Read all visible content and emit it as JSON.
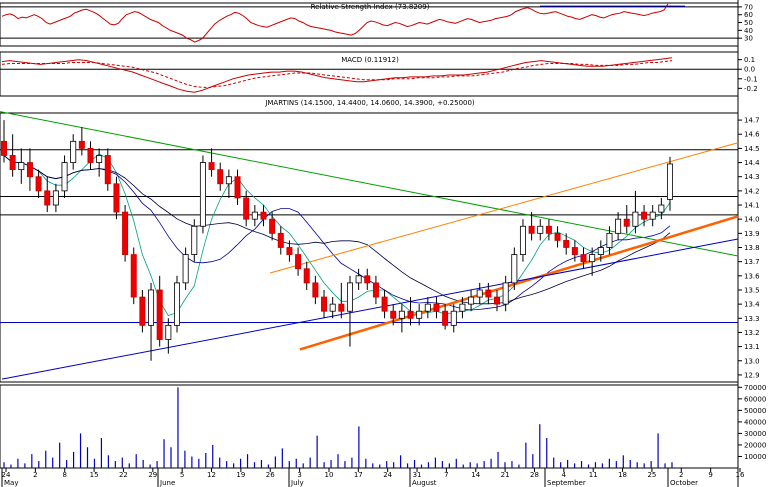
{
  "chart_data": {
    "type": "candlestick",
    "panels": {
      "rsi": {
        "title": "Relative Strength Index (73.8209)",
        "yticks": [
          70,
          60,
          50,
          40,
          30
        ],
        "ylim": [
          20,
          75
        ],
        "levels": [
          70,
          30
        ],
        "values": [
          58,
          60,
          61,
          59,
          55,
          57,
          56,
          58,
          60,
          58,
          55,
          50,
          48,
          50,
          52,
          54,
          56,
          58,
          62,
          64,
          66,
          67,
          65,
          63,
          60,
          56,
          52,
          48,
          47,
          49,
          55,
          60,
          62,
          64,
          63,
          60,
          57,
          54,
          52,
          50,
          46,
          43,
          40,
          38,
          36,
          34,
          30,
          28,
          25,
          27,
          30,
          36,
          42,
          48,
          52,
          55,
          58,
          60,
          63,
          62,
          59,
          55,
          50,
          48,
          46,
          45,
          44,
          46,
          48,
          50,
          52,
          54,
          56,
          55,
          52,
          50,
          47,
          45,
          44,
          43,
          42,
          41,
          40,
          38,
          37,
          36,
          35,
          34,
          36,
          40,
          45,
          50,
          52,
          51,
          49,
          47,
          46,
          48,
          50,
          49,
          47,
          45,
          46,
          48,
          50,
          49,
          48,
          50,
          52,
          54,
          53,
          51,
          50,
          49,
          51,
          53,
          55,
          54,
          52,
          50,
          51,
          52,
          53,
          55,
          56,
          57,
          58,
          60,
          64,
          66,
          68,
          69,
          67,
          64,
          62,
          61,
          62,
          63,
          64,
          62,
          60,
          58,
          57,
          55,
          54,
          56,
          58,
          60,
          59,
          57,
          56,
          58,
          60,
          61,
          62,
          64,
          63,
          62,
          61,
          60,
          59,
          60,
          62,
          63,
          64,
          66,
          73.8
        ]
      },
      "macd": {
        "title": "MACD (0.11912)",
        "yticks": [
          0.1,
          0.0,
          -0.1,
          -0.2
        ],
        "ylim": [
          -0.28,
          0.18
        ],
        "macd": [
          0.08,
          0.09,
          0.08,
          0.07,
          0.06,
          0.05,
          0.06,
          0.07,
          0.08,
          0.09,
          0.1,
          0.09,
          0.07,
          0.05,
          0.03,
          0.01,
          -0.01,
          -0.03,
          -0.06,
          -0.09,
          -0.12,
          -0.15,
          -0.18,
          -0.21,
          -0.23,
          -0.24,
          -0.22,
          -0.19,
          -0.16,
          -0.13,
          -0.1,
          -0.08,
          -0.06,
          -0.05,
          -0.04,
          -0.03,
          -0.03,
          -0.02,
          -0.02,
          -0.03,
          -0.05,
          -0.07,
          -0.09,
          -0.1,
          -0.11,
          -0.12,
          -0.13,
          -0.13,
          -0.12,
          -0.11,
          -0.1,
          -0.09,
          -0.09,
          -0.08,
          -0.08,
          -0.08,
          -0.07,
          -0.07,
          -0.06,
          -0.06,
          -0.06,
          -0.05,
          -0.04,
          -0.03,
          -0.01,
          0.01,
          0.03,
          0.05,
          0.07,
          0.08,
          0.09,
          0.08,
          0.07,
          0.06,
          0.05,
          0.04,
          0.03,
          0.03,
          0.03,
          0.04,
          0.05,
          0.06,
          0.07,
          0.08,
          0.09,
          0.1,
          0.11,
          0.12
        ],
        "signal": [
          0.05,
          0.06,
          0.06,
          0.06,
          0.06,
          0.06,
          0.06,
          0.06,
          0.06,
          0.07,
          0.07,
          0.07,
          0.07,
          0.06,
          0.05,
          0.04,
          0.03,
          0.02,
          0.0,
          -0.02,
          -0.04,
          -0.07,
          -0.1,
          -0.13,
          -0.16,
          -0.18,
          -0.19,
          -0.19,
          -0.18,
          -0.17,
          -0.15,
          -0.13,
          -0.11,
          -0.09,
          -0.08,
          -0.07,
          -0.06,
          -0.05,
          -0.04,
          -0.04,
          -0.04,
          -0.05,
          -0.06,
          -0.07,
          -0.08,
          -0.09,
          -0.1,
          -0.11,
          -0.11,
          -0.11,
          -0.11,
          -0.1,
          -0.1,
          -0.1,
          -0.09,
          -0.09,
          -0.09,
          -0.08,
          -0.08,
          -0.07,
          -0.07,
          -0.07,
          -0.06,
          -0.05,
          -0.04,
          -0.03,
          -0.01,
          0.01,
          0.02,
          0.04,
          0.05,
          0.06,
          0.06,
          0.06,
          0.06,
          0.05,
          0.05,
          0.04,
          0.04,
          0.04,
          0.04,
          0.05,
          0.05,
          0.06,
          0.07,
          0.07,
          0.08,
          0.09
        ]
      },
      "price": {
        "title": "JMARTINS (14.1500, 14.4400, 14.0600, 14.3900, +0.25000)",
        "yticks": [
          14.7,
          14.6,
          14.5,
          14.4,
          14.3,
          14.2,
          14.1,
          14.0,
          13.9,
          13.8,
          13.7,
          13.6,
          13.5,
          13.4,
          13.3,
          13.2,
          13.1,
          13.0,
          12.9
        ],
        "ylim": [
          12.85,
          14.75
        ],
        "hlines": [
          14.49,
          14.16,
          14.03,
          13.27
        ],
        "candles": [
          [
            14.55,
            14.7,
            14.4,
            14.45
          ],
          [
            14.45,
            14.6,
            14.3,
            14.35
          ],
          [
            14.35,
            14.5,
            14.25,
            14.4
          ],
          [
            14.4,
            14.5,
            14.2,
            14.3
          ],
          [
            14.3,
            14.35,
            14.15,
            14.2
          ],
          [
            14.2,
            14.3,
            14.05,
            14.1
          ],
          [
            14.1,
            14.25,
            14.05,
            14.2
          ],
          [
            14.2,
            14.45,
            14.15,
            14.4
          ],
          [
            14.4,
            14.6,
            14.35,
            14.55
          ],
          [
            14.55,
            14.65,
            14.45,
            14.5
          ],
          [
            14.5,
            14.55,
            14.35,
            14.4
          ],
          [
            14.4,
            14.5,
            14.3,
            14.45
          ],
          [
            14.45,
            14.5,
            14.2,
            14.25
          ],
          [
            14.25,
            14.3,
            14.0,
            14.05
          ],
          [
            14.05,
            14.1,
            13.7,
            13.75
          ],
          [
            13.75,
            13.8,
            13.4,
            13.45
          ],
          [
            13.45,
            13.5,
            13.2,
            13.25
          ],
          [
            13.25,
            13.55,
            13.0,
            13.5
          ],
          [
            13.5,
            13.6,
            13.1,
            13.15
          ],
          [
            13.15,
            13.3,
            13.05,
            13.25
          ],
          [
            13.25,
            13.6,
            13.2,
            13.55
          ],
          [
            13.55,
            13.8,
            13.5,
            13.75
          ],
          [
            13.75,
            14.0,
            13.7,
            13.95
          ],
          [
            13.95,
            14.45,
            13.9,
            14.4
          ],
          [
            14.4,
            14.5,
            14.3,
            14.35
          ],
          [
            14.35,
            14.4,
            14.2,
            14.25
          ],
          [
            14.25,
            14.35,
            14.15,
            14.3
          ],
          [
            14.3,
            14.35,
            14.1,
            14.15
          ],
          [
            14.15,
            14.2,
            13.95,
            14.0
          ],
          [
            14.0,
            14.1,
            13.95,
            14.05
          ],
          [
            14.05,
            14.1,
            13.95,
            14.0
          ],
          [
            14.0,
            14.05,
            13.85,
            13.9
          ],
          [
            13.9,
            13.95,
            13.75,
            13.8
          ],
          [
            13.8,
            13.85,
            13.7,
            13.75
          ],
          [
            13.75,
            13.8,
            13.6,
            13.65
          ],
          [
            13.65,
            13.7,
            13.5,
            13.55
          ],
          [
            13.55,
            13.6,
            13.4,
            13.45
          ],
          [
            13.45,
            13.5,
            13.3,
            13.35
          ],
          [
            13.35,
            13.45,
            13.3,
            13.4
          ],
          [
            13.4,
            13.55,
            13.3,
            13.35
          ],
          [
            13.35,
            13.6,
            13.1,
            13.55
          ],
          [
            13.55,
            13.65,
            13.5,
            13.6
          ],
          [
            13.6,
            13.65,
            13.5,
            13.55
          ],
          [
            13.55,
            13.6,
            13.4,
            13.45
          ],
          [
            13.45,
            13.5,
            13.3,
            13.35
          ],
          [
            13.35,
            13.4,
            13.25,
            13.3
          ],
          [
            13.3,
            13.4,
            13.2,
            13.35
          ],
          [
            13.35,
            13.45,
            13.25,
            13.3
          ],
          [
            13.3,
            13.4,
            13.25,
            13.35
          ],
          [
            13.35,
            13.45,
            13.3,
            13.4
          ],
          [
            13.4,
            13.45,
            13.3,
            13.35
          ],
          [
            13.35,
            13.4,
            13.22,
            13.25
          ],
          [
            13.25,
            13.4,
            13.2,
            13.35
          ],
          [
            13.35,
            13.45,
            13.3,
            13.4
          ],
          [
            13.4,
            13.5,
            13.35,
            13.45
          ],
          [
            13.45,
            13.55,
            13.4,
            13.5
          ],
          [
            13.5,
            13.55,
            13.4,
            13.45
          ],
          [
            13.45,
            13.5,
            13.35,
            13.4
          ],
          [
            13.4,
            13.6,
            13.35,
            13.55
          ],
          [
            13.55,
            13.8,
            13.5,
            13.75
          ],
          [
            13.75,
            14.0,
            13.7,
            13.95
          ],
          [
            13.95,
            14.05,
            13.85,
            13.9
          ],
          [
            13.9,
            14.0,
            13.85,
            13.95
          ],
          [
            13.95,
            14.0,
            13.85,
            13.9
          ],
          [
            13.9,
            13.95,
            13.8,
            13.85
          ],
          [
            13.85,
            13.9,
            13.75,
            13.8
          ],
          [
            13.8,
            13.85,
            13.7,
            13.75
          ],
          [
            13.75,
            13.8,
            13.65,
            13.7
          ],
          [
            13.7,
            13.8,
            13.6,
            13.75
          ],
          [
            13.75,
            13.85,
            13.7,
            13.8
          ],
          [
            13.8,
            13.95,
            13.75,
            13.9
          ],
          [
            13.9,
            14.05,
            13.85,
            14.0
          ],
          [
            14.0,
            14.1,
            13.9,
            13.95
          ],
          [
            13.95,
            14.2,
            13.9,
            14.05
          ],
          [
            14.05,
            14.1,
            13.95,
            14.0
          ],
          [
            14.0,
            14.1,
            13.95,
            14.05
          ],
          [
            14.05,
            14.15,
            14.0,
            14.1
          ],
          [
            14.14,
            14.44,
            14.06,
            14.39
          ]
        ]
      },
      "volume": {
        "yticks": [
          70000,
          60000,
          50000,
          40000,
          30000,
          20000,
          10000
        ],
        "ylim": [
          0,
          72000
        ],
        "values": [
          5000,
          3000,
          8000,
          4000,
          12000,
          6000,
          15000,
          9000,
          22000,
          7000,
          14000,
          30000,
          18000,
          8000,
          26000,
          11000,
          6000,
          9000,
          4000,
          12000,
          7000,
          3000,
          6000,
          25000,
          18000,
          70000,
          15000,
          10000,
          8000,
          13000,
          20000,
          9000,
          6000,
          4000,
          8000,
          12000,
          5000,
          7000,
          3000,
          10000,
          17000,
          6000,
          8000,
          4000,
          9000,
          28000,
          5000,
          7000,
          12000,
          6000,
          9000,
          36000,
          8000,
          4000,
          3000,
          6000,
          5000,
          11000,
          4000,
          7000,
          3000,
          5000,
          9000,
          6000,
          4000,
          8000,
          3000,
          5000,
          4000,
          6000,
          8000,
          14000,
          5000,
          6000,
          3000,
          22000,
          12000,
          38000,
          26000,
          9000,
          5000,
          7000,
          4000,
          6000,
          3000,
          5000,
          4000,
          8000,
          6000,
          11000,
          7000,
          5000,
          4000,
          6000,
          30000,
          4000,
          5000
        ]
      }
    },
    "xaxis": {
      "days": [
        "24",
        "2",
        "8",
        "15",
        "22",
        "29",
        "5",
        "12",
        "19",
        "26",
        "3",
        "10",
        "17",
        "24",
        "31",
        "7",
        "14",
        "21",
        "28",
        "4",
        "11",
        "18",
        "25",
        "2",
        "9",
        "16"
      ],
      "months": [
        "May",
        "June",
        "July",
        "August",
        "September",
        "October"
      ]
    },
    "trendlines": [
      {
        "color": "#00a000",
        "desc": "downtrend"
      },
      {
        "color": "#ff8000",
        "desc": "upper channel"
      },
      {
        "color": "#ff6000",
        "desc": "support"
      },
      {
        "color": "#0000c0",
        "desc": "long support"
      }
    ]
  }
}
